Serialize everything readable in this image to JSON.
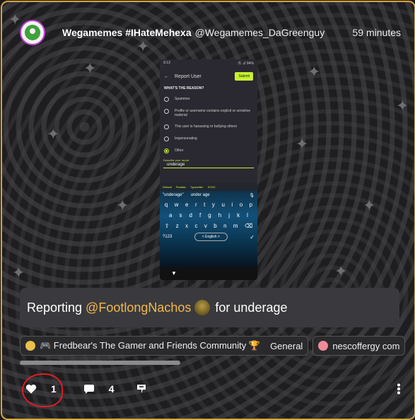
{
  "post": {
    "author_name": "Wegamemes #IHateMehexa",
    "author_handle": "@Wegamemes_DaGreenguy",
    "time_ago": "59 minutes",
    "text_before": "Reporting",
    "mention": "@FootlongNachos",
    "text_after": "for underage"
  },
  "screenshot": {
    "status_time": "9:13",
    "status_right": "Ⓡ ⊿ 84%",
    "title": "Report User",
    "submit_label": "Submit",
    "question": "WHAT'S THE REASON?",
    "options": [
      {
        "label": "Spammer",
        "selected": false
      },
      {
        "label": "Profile or username contains explicit or sensitive material",
        "selected": false
      },
      {
        "label": "This user is harassing or bullying others",
        "selected": false
      },
      {
        "label": "Impersonating",
        "selected": false
      },
      {
        "label": "Other",
        "selected": true
      }
    ],
    "describe_label": "Describe your report",
    "describe_value": "underage",
    "keyboard_tabs": [
      "Default",
      "Parallax",
      "Typewriter",
      "SYNC"
    ],
    "suggestions": [
      "\"underage\"",
      "under age"
    ],
    "row1": [
      "q",
      "w",
      "e",
      "r",
      "t",
      "y",
      "u",
      "i",
      "o",
      "p"
    ],
    "row2": [
      "a",
      "s",
      "d",
      "f",
      "g",
      "h",
      "j",
      "k",
      "l"
    ],
    "row3": [
      "z",
      "x",
      "c",
      "v",
      "b",
      "n",
      "m"
    ],
    "sym_key": "?123",
    "space_label": "< English >"
  },
  "chips": [
    {
      "label": "🎮 Fredbear's The Gamer and Friends Community 🏆",
      "sub": "General"
    },
    {
      "label": "nescoffergy com",
      "sub": ""
    }
  ],
  "actions": {
    "like_count": "1",
    "comment_count": "4"
  },
  "colors": {
    "accent_border": "#d6a43a",
    "mention": "#f2b84a",
    "highlight_circle": "#e01d25"
  }
}
